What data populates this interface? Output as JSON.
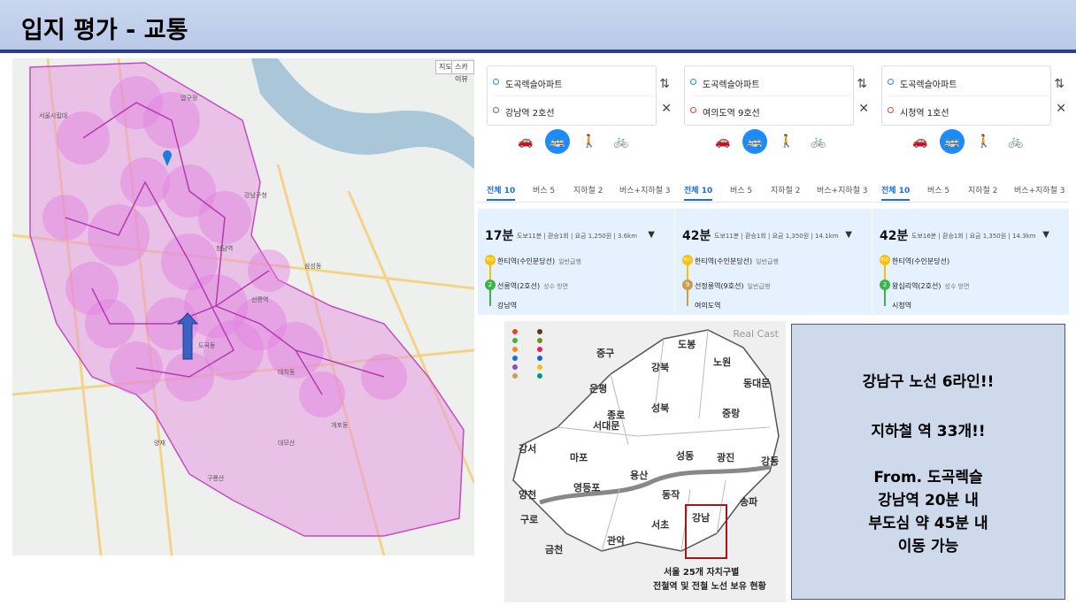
{
  "header": {
    "title": "입지 평가 - 교통"
  },
  "map": {
    "buttons": [
      "지도",
      "스카이뷰"
    ],
    "labels": [
      "청담역",
      "강남구청",
      "삼성동",
      "선릉역",
      "대치동",
      "개포동",
      "도곡동",
      "양재",
      "대모산",
      "구룡산",
      "서울시립대",
      "압구정"
    ],
    "colors": {
      "area": "#e59be0",
      "circle": "#e27ee0",
      "river": "#a9c7d9",
      "arrow": "#3a62c2"
    }
  },
  "panels": [
    {
      "origin": "도곡렉슬아파트",
      "destination": "강남역 2호선",
      "tabs": [
        "전체 10",
        "버스 5",
        "지하철 2",
        "버스+지하철 3"
      ],
      "time": "17분",
      "meta": "도보11분 | 환승1회 | 요금 1,250원 | 3.6km",
      "stops": [
        {
          "badge": "버스",
          "name": "한티역(수인분당선)",
          "sub": "일반급행"
        },
        {
          "badge": "2",
          "name": "선릉역(2호선)",
          "sub": "성수 방면"
        },
        {
          "badge": "",
          "name": "강남역",
          "sub": ""
        }
      ],
      "colors": {
        "line1": "#f5c20a",
        "line2": "#3cb44b"
      }
    },
    {
      "origin": "도곡렉슬아파트",
      "destination": "여의도역 9호선",
      "tabs": [
        "전체 10",
        "버스 5",
        "지하철 2",
        "버스+지하철 3"
      ],
      "time": "42분",
      "meta": "도보11분 | 환승1회 | 요금 1,350원 | 14.1km",
      "stops": [
        {
          "badge": "버스",
          "name": "한티역(수인분당선)",
          "sub": "일반급행"
        },
        {
          "badge": "9",
          "name": "선정릉역(9호선)",
          "sub": "일반급행"
        },
        {
          "badge": "",
          "name": "여의도역",
          "sub": ""
        }
      ],
      "colors": {
        "line1": "#f5c20a",
        "line2": "#c8a04b"
      }
    },
    {
      "origin": "도곡렉슬아파트",
      "destination": "시청역 1호선",
      "tabs": [
        "전체 10",
        "버스 5",
        "지하철 2",
        "버스+지하철 3"
      ],
      "time": "42분",
      "meta": "도보16분 | 환승1회 | 요금 1,350원 | 14.3km",
      "stops": [
        {
          "badge": "버스",
          "name": "한티역(수인분당선)",
          "sub": ""
        },
        {
          "badge": "2",
          "name": "왕십리역(2호선)",
          "sub": "성수 방면"
        },
        {
          "badge": "",
          "name": "시청역",
          "sub": ""
        }
      ],
      "colors": {
        "line1": "#f5c20a",
        "line2": "#3cb44b"
      }
    }
  ],
  "infographic": {
    "logo": "Real Cast",
    "districts": [
      "도봉",
      "노원",
      "강북",
      "중구",
      "은평",
      "성북",
      "동대문",
      "중랑",
      "종로",
      "서대문",
      "마포",
      "강서",
      "양천",
      "영등포",
      "용산",
      "성동",
      "광진",
      "강동",
      "동작",
      "서초",
      "강남",
      "송파",
      "구로",
      "금천",
      "관악"
    ],
    "caption_line1": "서울 25개 자치구별",
    "caption_line2": "전철역 및 전철 노선 보유 현황"
  },
  "textbox": {
    "lines": [
      "강남구 노선 6라인!!",
      "지하철 역 33개!!",
      "From. 도곡렉슬",
      "강남역 20분 내",
      "부도심 약 45분 내",
      "이동 가능"
    ]
  }
}
